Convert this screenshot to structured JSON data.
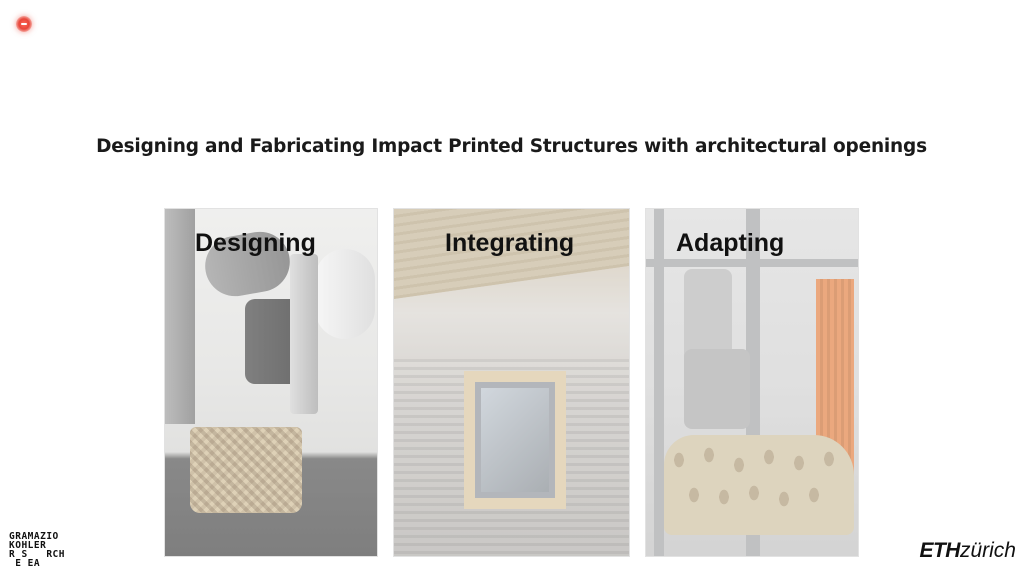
{
  "slide": {
    "title": "Designing and Fabricating Impact Printed Structures with architectural openings"
  },
  "recording_indicator": {
    "icon": "record-icon",
    "color": "#e8463a"
  },
  "cards": [
    {
      "label": "Designing",
      "image": "robot-printing-basket-photo"
    },
    {
      "label": "Integrating",
      "image": "printed-wall-with-window-photo"
    },
    {
      "label": "Adapting",
      "image": "printed-wall-in-robot-rack-photo"
    }
  ],
  "logos": {
    "gramazio_kohler": {
      "lines": [
        "GRAMAZIO",
        "KOHLER",
        "R S   RCH",
        " E EA"
      ]
    },
    "eth": {
      "eth_text": "ETH",
      "zurich_text": "zürich"
    }
  }
}
